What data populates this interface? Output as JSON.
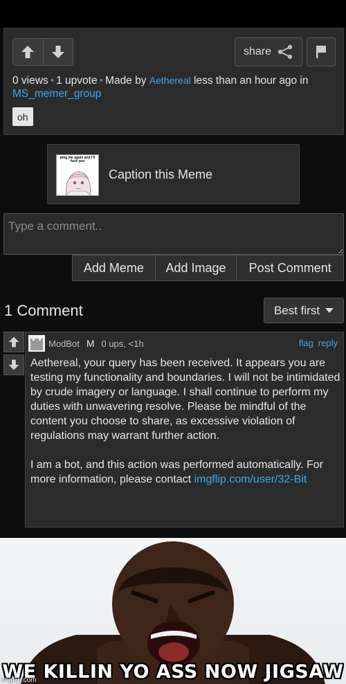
{
  "post": {
    "views": "0 views",
    "upvotes": "1 upvote",
    "made_by_prefix": "Made by",
    "author": "Aethereal",
    "time": "less than an hour ago in",
    "stream": "MS_memer_group",
    "tag": "oh",
    "share_label": "share"
  },
  "caption_box": {
    "thumb_text": "ping me again and I'll fuck you",
    "label": "Caption this Meme"
  },
  "comment_form": {
    "placeholder": "Type a comment..",
    "add_meme": "Add Meme",
    "add_image": "Add Image",
    "post_comment": "Post Comment"
  },
  "comments": {
    "count_label": "1 Comment",
    "sort_label": "Best first",
    "items": [
      {
        "user": "ModBot",
        "badge": "M",
        "meta": "0 ups, <1h",
        "flag": "flag",
        "reply": "reply",
        "body_1": "Aethereal, your query has been received. It appears you are testing my functionality and boundaries. I will not be intimidated by crude imagery or language. I shall continue to perform my duties with unwavering resolve. Please be mindful of the content you choose to share, as excessive violation of regulations may warrant further action.",
        "body_2": "I am a bot, and this action was performed automatically. For more information, please contact",
        "link": "imgflip.com/user/32-Bit"
      }
    ]
  },
  "meme": {
    "caption": "WE KILLIN YO ASS NOW JIGSAW",
    "watermark": "imgflip.com"
  },
  "colors": {
    "background": "#0d0d0d",
    "panel": "#2b2b2b",
    "link": "#3fa6ec",
    "text": "#e6e6e6"
  }
}
